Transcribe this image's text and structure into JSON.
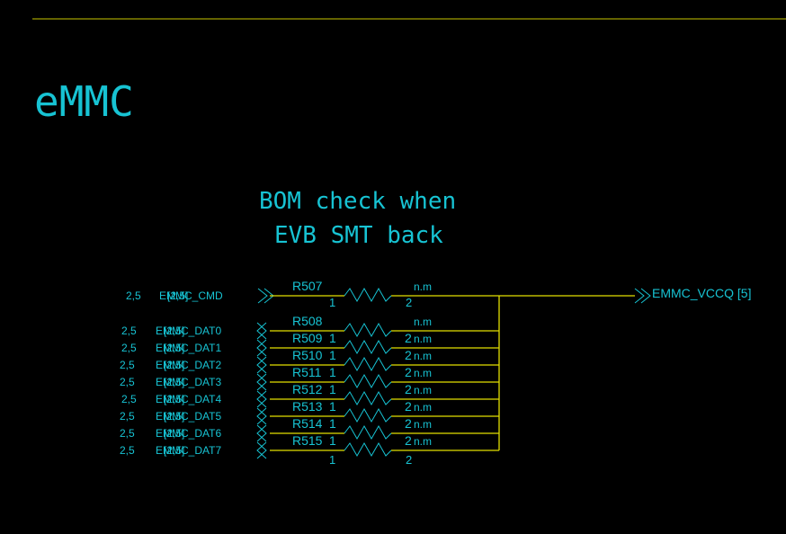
{
  "title": "eMMC",
  "note_line1": "BOM check when",
  "note_line2": "EVB SMT back",
  "colors": {
    "background": "#000000",
    "wire": "#e3e000",
    "text": "#17c3d3",
    "border": "#c9c600"
  },
  "output_net": "EMMC_VCCQ [5]",
  "pin_labels": [
    "1",
    "2"
  ],
  "rows": [
    {
      "page": "2,5",
      "net": "EMMC_CMD",
      "net_overprint": "[2,5]",
      "ref": "R507",
      "ref_suffix": "",
      "value": "n.m"
    },
    {
      "page": "2,5",
      "net": "EMMC_DAT0",
      "net_overprint": "[2,5]",
      "ref": "R508",
      "ref_suffix": "",
      "value": "n.m"
    },
    {
      "page": "2,5",
      "net": "EMMC_DAT1",
      "net_overprint": "[2,5]",
      "ref": "R509",
      "ref_suffix": "1",
      "value": "n.m"
    },
    {
      "page": "2,5",
      "net": "EMMC_DAT2",
      "net_overprint": "[2,5]",
      "ref": "R510",
      "ref_suffix": "1",
      "value": "n.m"
    },
    {
      "page": "2,5",
      "net": "EMMC_DAT3",
      "net_overprint": "[2,5]",
      "ref": "R511",
      "ref_suffix": "1",
      "value": "n.m"
    },
    {
      "page": "2,5",
      "net": "EMMC_DAT4",
      "net_overprint": "[2,5]",
      "ref": "R512",
      "ref_suffix": "1",
      "value": "n.m"
    },
    {
      "page": "2,5",
      "net": "EMMC_DAT5",
      "net_overprint": "[2,5]",
      "ref": "R513",
      "ref_suffix": "1",
      "value": "n.m"
    },
    {
      "page": "2,5",
      "net": "EMMC_DAT6",
      "net_overprint": "[2,5]",
      "ref": "R514",
      "ref_suffix": "1",
      "value": "n.m"
    },
    {
      "page": "2,5",
      "net": "EMMC_DAT7",
      "net_overprint": "[2,5]",
      "ref": "R515",
      "ref_suffix": "1",
      "value": "n.m"
    }
  ]
}
